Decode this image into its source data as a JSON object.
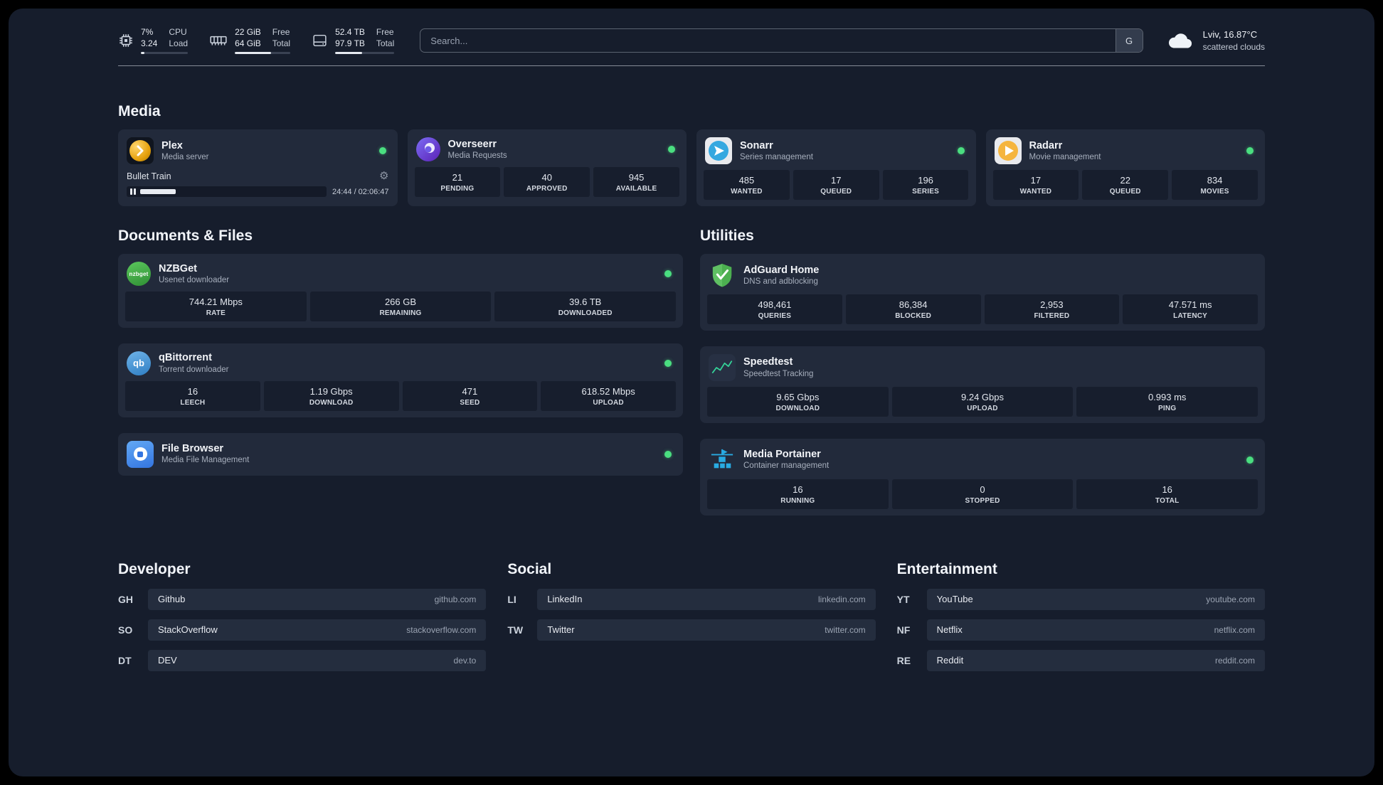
{
  "colors": {
    "status_online": "#4ade80",
    "accent_plex": "#e5a00d",
    "accent_green": "#4ade80",
    "accent_blue": "#38bdf8"
  },
  "icons": {
    "settings": "⚙",
    "search_provider": "G"
  },
  "topbar": {
    "cpu": {
      "value_top": "7%",
      "value_bottom": "3.24",
      "label_top": "CPU",
      "label_bottom": "Load",
      "percent": 7
    },
    "memory": {
      "value_top": "22 GiB",
      "value_bottom": "64 GiB",
      "label_top": "Free",
      "label_bottom": "Total",
      "percent": 65
    },
    "disk": {
      "value_top": "52.4 TB",
      "value_bottom": "97.9 TB",
      "label_top": "Free",
      "label_bottom": "Total",
      "percent": 46
    },
    "search": {
      "placeholder": "Search...",
      "button": "G"
    },
    "weather": {
      "location": "Lviv, 16.87°C",
      "condition": "scattered clouds"
    }
  },
  "media": {
    "heading": "Media",
    "plex": {
      "title": "Plex",
      "subtitle": "Media server",
      "status": "online",
      "now_playing": "Bullet Train",
      "time": "24:44 / 02:06:47",
      "progress_percent": 19.5
    },
    "cards": [
      {
        "title": "Overseerr",
        "subtitle": "Media Requests",
        "status": "online",
        "stats": [
          {
            "value": "21",
            "label": "PENDING"
          },
          {
            "value": "40",
            "label": "APPROVED"
          },
          {
            "value": "945",
            "label": "AVAILABLE"
          }
        ]
      },
      {
        "title": "Sonarr",
        "subtitle": "Series management",
        "status": "online",
        "stats": [
          {
            "value": "485",
            "label": "WANTED"
          },
          {
            "value": "17",
            "label": "QUEUED"
          },
          {
            "value": "196",
            "label": "SERIES"
          }
        ]
      },
      {
        "title": "Radarr",
        "subtitle": "Movie management",
        "status": "online",
        "stats": [
          {
            "value": "17",
            "label": "WANTED"
          },
          {
            "value": "22",
            "label": "QUEUED"
          },
          {
            "value": "834",
            "label": "MOVIES"
          }
        ]
      }
    ]
  },
  "documents": {
    "heading": "Documents & Files",
    "cards": [
      {
        "title": "NZBGet",
        "subtitle": "Usenet downloader",
        "status": "online",
        "icon_text": "nzbget",
        "stats": [
          {
            "value": "744.21 Mbps",
            "label": "RATE"
          },
          {
            "value": "266 GB",
            "label": "REMAINING"
          },
          {
            "value": "39.6 TB",
            "label": "DOWNLOADED"
          }
        ]
      },
      {
        "title": "qBittorrent",
        "subtitle": "Torrent downloader",
        "status": "online",
        "icon_text": "qb",
        "stats": [
          {
            "value": "16",
            "label": "LEECH"
          },
          {
            "value": "1.19 Gbps",
            "label": "DOWNLOAD"
          },
          {
            "value": "471",
            "label": "SEED"
          },
          {
            "value": "618.52 Mbps",
            "label": "UPLOAD"
          }
        ]
      },
      {
        "title": "File Browser",
        "subtitle": "Media File Management",
        "status": "online",
        "stats": []
      }
    ]
  },
  "utilities": {
    "heading": "Utilities",
    "cards": [
      {
        "title": "AdGuard Home",
        "subtitle": "DNS and adblocking",
        "stats": [
          {
            "value": "498,461",
            "label": "QUERIES"
          },
          {
            "value": "86,384",
            "label": "BLOCKED"
          },
          {
            "value": "2,953",
            "label": "FILTERED"
          },
          {
            "value": "47.571 ms",
            "label": "LATENCY"
          }
        ]
      },
      {
        "title": "Speedtest",
        "subtitle": "Speedtest Tracking",
        "stats": [
          {
            "value": "9.65 Gbps",
            "label": "DOWNLOAD"
          },
          {
            "value": "9.24 Gbps",
            "label": "UPLOAD"
          },
          {
            "value": "0.993 ms",
            "label": "PING"
          }
        ]
      },
      {
        "title": "Media Portainer",
        "subtitle": "Container management",
        "status": "online",
        "stats": [
          {
            "value": "16",
            "label": "RUNNING"
          },
          {
            "value": "0",
            "label": "STOPPED"
          },
          {
            "value": "16",
            "label": "TOTAL"
          }
        ]
      }
    ]
  },
  "bookmarks": [
    {
      "heading": "Developer",
      "items": [
        {
          "abbr": "GH",
          "name": "Github",
          "url": "github.com"
        },
        {
          "abbr": "SO",
          "name": "StackOverflow",
          "url": "stackoverflow.com"
        },
        {
          "abbr": "DT",
          "name": "DEV",
          "url": "dev.to"
        }
      ]
    },
    {
      "heading": "Social",
      "items": [
        {
          "abbr": "LI",
          "name": "LinkedIn",
          "url": "linkedin.com"
        },
        {
          "abbr": "TW",
          "name": "Twitter",
          "url": "twitter.com"
        }
      ]
    },
    {
      "heading": "Entertainment",
      "items": [
        {
          "abbr": "YT",
          "name": "YouTube",
          "url": "youtube.com"
        },
        {
          "abbr": "NF",
          "name": "Netflix",
          "url": "netflix.com"
        },
        {
          "abbr": "RE",
          "name": "Reddit",
          "url": "reddit.com"
        }
      ]
    }
  ]
}
